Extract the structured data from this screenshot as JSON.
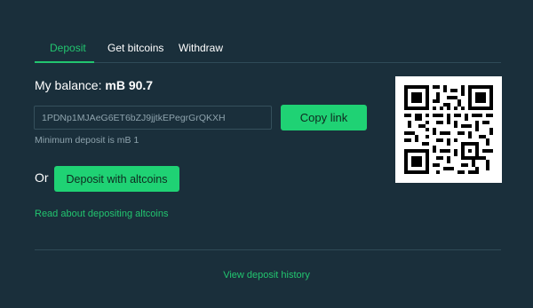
{
  "tabs": [
    {
      "label": "Deposit",
      "active": true
    },
    {
      "label": "Get bitcoins",
      "active": false
    },
    {
      "label": "Withdraw",
      "active": false
    }
  ],
  "balance": {
    "label": "My balance:",
    "value": "mB 90.7"
  },
  "deposit": {
    "address": "1PDNp1MJAeG6ET6bZJ9jjtkEPegrGrQKXH",
    "copy_label": "Copy link",
    "min_deposit_text": "Minimum deposit is mB 1"
  },
  "altcoins": {
    "or_label": "Or",
    "button_label": "Deposit with altcoins",
    "read_link": "Read about depositing altcoins"
  },
  "history_link": "View deposit history",
  "qr_icon": "qr-code",
  "colors": {
    "background": "#1a2f3b",
    "accent": "#22c56f",
    "button": "#1fd274",
    "muted_text": "#8ea3ad"
  }
}
